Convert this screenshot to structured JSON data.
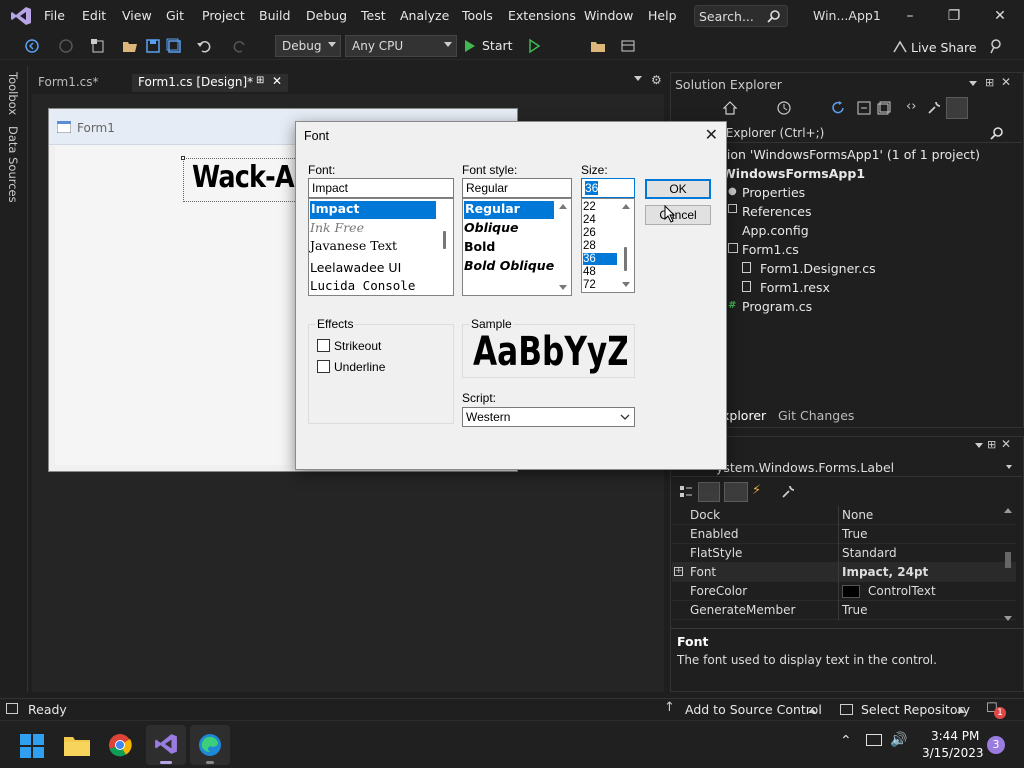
{
  "menubar": {
    "items": [
      "File",
      "Edit",
      "View",
      "Git",
      "Project",
      "Build",
      "Debug",
      "Test",
      "Analyze",
      "Tools",
      "Extensions",
      "Window",
      "Help"
    ],
    "search_label": "Search...",
    "window_title": "Win...App1"
  },
  "toolbar": {
    "config": "Debug",
    "platform": "Any CPU",
    "start_label": "Start",
    "live_share": "Live Share"
  },
  "left_strip": {
    "toolbox": "Toolbox",
    "data_sources": "Data Sources"
  },
  "editor_tabs": [
    {
      "label": "Form1.cs*"
    },
    {
      "label": "Form1.cs [Design]*"
    }
  ],
  "designer": {
    "form_caption": "Form1",
    "label_text": "Wack-A-"
  },
  "solution_explorer": {
    "title": "Solution Explorer",
    "search": "lution Explorer (Ctrl+;)",
    "rows": [
      "tion 'WindowsFormsApp1' (1 of 1 project)",
      "WindowsFormsApp1",
      "Properties",
      "References",
      "App.config",
      "Form1.cs",
      "Form1.Designer.cs",
      "Form1.resx",
      "Program.cs"
    ],
    "bottom_tabs": [
      "xplorer",
      "Git Changes"
    ]
  },
  "properties": {
    "object": "ystem.Windows.Forms.Label",
    "rows": [
      {
        "name": "Dock",
        "value": "None"
      },
      {
        "name": "Enabled",
        "value": "True"
      },
      {
        "name": "FlatStyle",
        "value": "Standard"
      },
      {
        "name": "Font",
        "value": "Impact, 24pt"
      },
      {
        "name": "ForeColor",
        "value": "ControlText"
      },
      {
        "name": "GenerateMember",
        "value": "True"
      }
    ],
    "desc_title": "Font",
    "desc_text": "The font used to display text in the control."
  },
  "font_dialog": {
    "title": "Font",
    "font_label": "Font:",
    "font_value": "Impact",
    "fonts": [
      "Impact",
      "Ink Free",
      "Javanese Text",
      "Leelawadee UI",
      "Lucida Console"
    ],
    "style_label": "Font style:",
    "style_value": "Regular",
    "styles": [
      "Regular",
      "Oblique",
      "Bold",
      "Bold Oblique"
    ],
    "size_label": "Size:",
    "size_value": "36",
    "sizes": [
      "22",
      "24",
      "26",
      "28",
      "36",
      "48",
      "72"
    ],
    "ok": "OK",
    "cancel": "Cancel",
    "effects_label": "Effects",
    "strikeout": "Strikeout",
    "underline": "Underline",
    "sample_label": "Sample",
    "sample_text": "AaBbYyZz",
    "script_label": "Script:",
    "script_value": "Western"
  },
  "statusbar": {
    "ready": "Ready",
    "source_control": "Add to Source Control",
    "repository": "Select Repository",
    "notif_count": "1"
  },
  "taskbar": {
    "time": "3:44 PM",
    "date": "3/15/2023",
    "badge": "3"
  }
}
